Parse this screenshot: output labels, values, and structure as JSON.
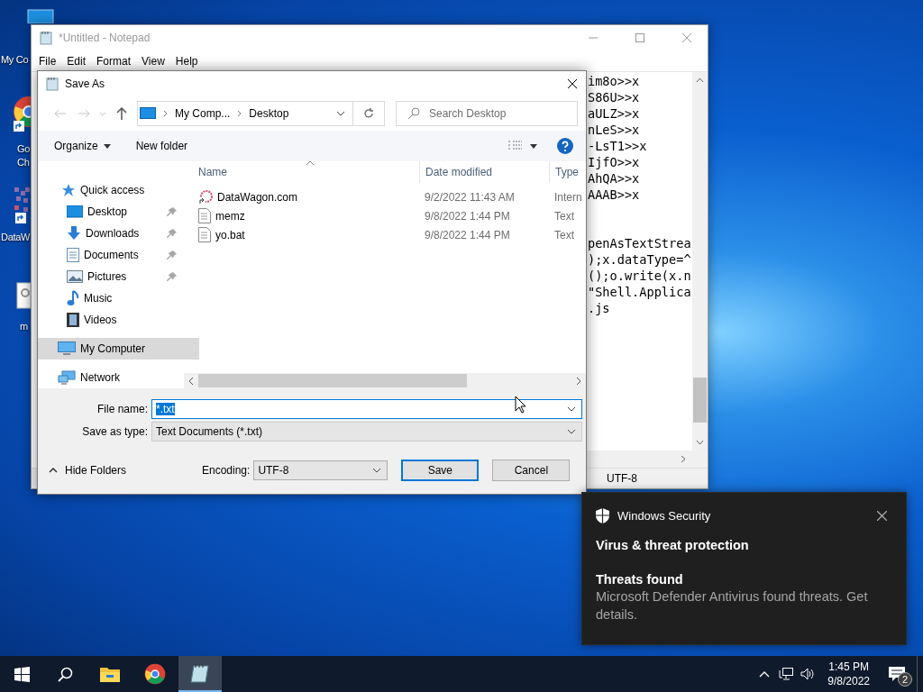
{
  "desktop": {
    "icons": [
      {
        "kind": "computer",
        "label": "My Co"
      },
      {
        "kind": "browser",
        "label": "Go Ch"
      },
      {
        "kind": "app",
        "label": "DataW"
      },
      {
        "kind": "file",
        "label": "m"
      }
    ]
  },
  "notepad": {
    "title": "*Untitled - Notepad",
    "menu": [
      "File",
      "Edit",
      "Format",
      "View",
      "Help"
    ],
    "blocks": [
      [
        "im8o>>x",
        "S86U>>x",
        "aULZ>>x",
        "nLeS>>x",
        "-LsT1>>x",
        "IjfO>>x",
        "AhQA>>x",
        "AAAB>>x"
      ],
      [
        "penAsTextStrea",
        ");x.dataType=^",
        "();o.write(x.n",
        "\"Shell.Applica",
        ".js"
      ]
    ],
    "status": "UTF-8"
  },
  "dialog": {
    "title": "Save As",
    "breadcrumb": [
      "My Comp...",
      "Desktop"
    ],
    "search": {
      "placeholder": "Search Desktop"
    },
    "toolbar": [
      "Organize",
      "New folder"
    ],
    "nav": [
      {
        "label": "Quick access",
        "kind": "star",
        "selected": false,
        "children": [
          {
            "label": "Desktop",
            "kind": "desktop",
            "pinned": true,
            "selected": false
          },
          {
            "label": "Downloads",
            "kind": "download",
            "pinned": true,
            "selected": false
          },
          {
            "label": "Documents",
            "kind": "document",
            "pinned": true,
            "selected": false
          },
          {
            "label": "Pictures",
            "kind": "picture",
            "pinned": true,
            "selected": false
          },
          {
            "label": "Music",
            "kind": "music",
            "pinned": false,
            "selected": false
          },
          {
            "label": "Videos",
            "kind": "video",
            "pinned": false,
            "selected": false
          }
        ]
      },
      {
        "label": "My Computer",
        "kind": "computer",
        "selected": true
      },
      {
        "label": "Network",
        "kind": "network",
        "selected": false
      }
    ],
    "columns": [
      "Name",
      "Date modified",
      "Type"
    ],
    "files": [
      {
        "name": "DataWagon.com",
        "kind": "shortcut",
        "date": "9/2/2022 11:43 AM",
        "type": "Intern"
      },
      {
        "name": "memz",
        "kind": "text",
        "date": "9/8/2022 1:44 PM",
        "type": "Text"
      },
      {
        "name": "yo.bat",
        "kind": "text",
        "date": "9/8/2022 1:44 PM",
        "type": "Text"
      }
    ],
    "file_name": {
      "label": "File name:",
      "value": "*.txt"
    },
    "save_as_type": {
      "label": "Save as type:",
      "value": "Text Documents (*.txt)"
    },
    "hide_folders": "Hide Folders",
    "encoding": {
      "label": "Encoding:",
      "value": "UTF-8"
    },
    "buttons": [
      {
        "label": "Save",
        "default": true
      },
      {
        "label": "Cancel",
        "default": false
      }
    ]
  },
  "notification": {
    "app": "Windows Security",
    "title": "Virus & threat protection",
    "heading": "Threats found",
    "body": "Microsoft Defender Antivirus found threats. Get details."
  },
  "taskbar": {
    "apps": [
      {
        "kind": "explorer",
        "selected": false
      },
      {
        "kind": "browser",
        "selected": false
      },
      {
        "kind": "notepad",
        "selected": true
      }
    ],
    "time": "1:45 PM",
    "date": "9/8/2022",
    "notifications": "2"
  }
}
